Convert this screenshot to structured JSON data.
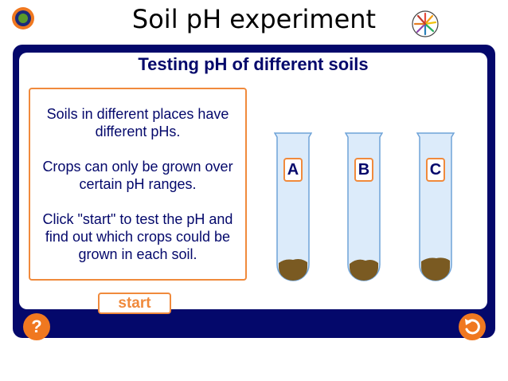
{
  "header": {
    "title": "Soil pH experiment",
    "logo_icon": "target-logo-icon",
    "burst_icon": "color-burst-icon"
  },
  "panel": {
    "heading": "Testing pH of different soils",
    "info_lines": [
      "Soils in different places have different pHs.",
      "Crops can only be grown over certain pH ranges.",
      "Click \"start\" to test the pH and find out which crops could be grown in each soil."
    ],
    "start_label": "start"
  },
  "tubes": [
    {
      "label": "A"
    },
    {
      "label": "B"
    },
    {
      "label": "C"
    }
  ],
  "controls": {
    "help_label": "?",
    "help_icon": "question-icon",
    "back_icon": "undo-arrow-icon"
  },
  "colors": {
    "frame": "#04086b",
    "accent": "#f08a3c",
    "button": "#f07820",
    "tube_glass": "#dcebfa",
    "soil": "#7a5a22"
  }
}
